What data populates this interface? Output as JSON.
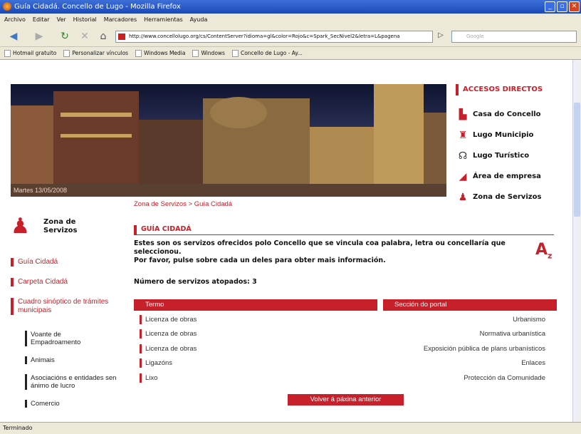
{
  "window": {
    "title": "Guía Cidadá. Concello de Lugo - Mozilla Firefox"
  },
  "menu": [
    "Archivo",
    "Editar",
    "Ver",
    "Historial",
    "Marcadores",
    "Herramientas",
    "Ayuda"
  ],
  "nav": {
    "url": "http://www.concellolugo.org/cs/ContentServer?idioma=gl&color=Rojo&c=Spark_SecNivel2&letra=L&pagena",
    "search_placeholder": "Google"
  },
  "bookmarks": [
    "Hotmail gratuito",
    "Personalizar vínculos",
    "Windows Media",
    "Windows",
    "Concello de Lugo - Ay..."
  ],
  "banner": {
    "date": "Martes 13/05/2008"
  },
  "accesos": {
    "title": "ACCESOS DIRECTOS",
    "items": [
      {
        "label": "Casa do Concello",
        "icon": "city-hall-icon"
      },
      {
        "label": "Lugo Municipio",
        "icon": "municipality-icon"
      },
      {
        "label": "Lugo Turístico",
        "icon": "tourism-icon"
      },
      {
        "label": "Área de empresa",
        "icon": "business-icon"
      },
      {
        "label": "Zona de Servizos",
        "icon": "services-icon"
      }
    ]
  },
  "left": {
    "zona_title_line1": "Zona de",
    "zona_title_line2": "Servizos",
    "primary": [
      "Guía Cidadá",
      "Carpeta Cidadá",
      "Cuadro sinóptico de trámites municipais"
    ],
    "secondary": [
      "Voante de Empadroamento",
      "Animais",
      "Asociacións e entidades sen ánimo de lucro",
      "Comercio"
    ]
  },
  "breadcrumb": "Zona de Servizos > Guía Cidadá",
  "section_title": "GUÍA CIDADÁ",
  "intro1": "Estes son os servizos ofrecidos polo Concello que se vincula coa palabra, letra ou concellaría que seleccionou.",
  "intro2": "Por favor, pulse sobre cada un deles para obter mais información.",
  "count_text": "Número de servizos atopados: 3",
  "table": {
    "headers": [
      "Termo",
      "Sección do portal"
    ],
    "rows": [
      {
        "term": "Licenza de obras",
        "section": "Urbanismo"
      },
      {
        "term": "Licenza de obras",
        "section": "Normativa urbanística"
      },
      {
        "term": "Licenza de obras",
        "section": "Exposición pública de plans urbanísticos"
      },
      {
        "term": "Ligazóns",
        "section": "Enlaces"
      },
      {
        "term": "Lixo",
        "section": "Protección da Comunidade"
      }
    ]
  },
  "back_button": "Volver á páxina anterior",
  "status": "Terminado",
  "colors": {
    "accent": "#c8202a",
    "chrome": "#ece9d8",
    "titlebar": "#1c48b8"
  }
}
